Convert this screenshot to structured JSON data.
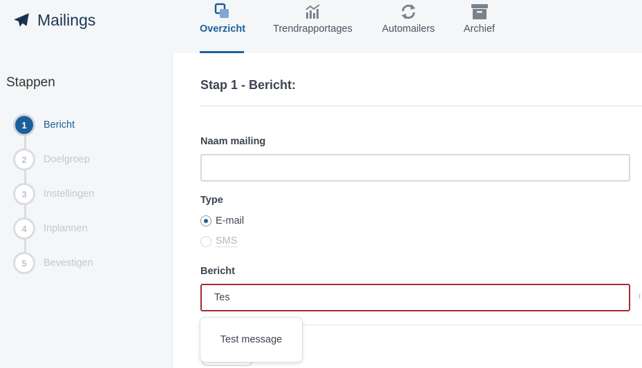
{
  "app": {
    "title": "Mailings",
    "icon": "paper-plane-icon"
  },
  "nav": {
    "tabs": [
      {
        "label": "Overzicht",
        "icon": "overview-squares-icon",
        "active": true
      },
      {
        "label": "Trendrapportages",
        "icon": "bar-chart-trend-icon",
        "active": false
      },
      {
        "label": "Automailers",
        "icon": "refresh-cycle-icon",
        "active": false
      },
      {
        "label": "Archief",
        "icon": "archive-box-icon",
        "active": false
      }
    ]
  },
  "sidebar": {
    "title": "Stappen",
    "steps": [
      {
        "number": "1",
        "label": "Bericht",
        "active": true
      },
      {
        "number": "2",
        "label": "Doelgroep",
        "active": false
      },
      {
        "number": "3",
        "label": "Instellingen",
        "active": false
      },
      {
        "number": "4",
        "label": "Inplannen",
        "active": false
      },
      {
        "number": "5",
        "label": "Bevestigen",
        "active": false
      }
    ]
  },
  "form": {
    "title": "Stap 1 - Bericht:",
    "name_label": "Naam mailing",
    "name_value": "",
    "type_label": "Type",
    "type_options": [
      {
        "label": "E-mail",
        "checked": true,
        "disabled": false
      },
      {
        "label": "SMS",
        "checked": false,
        "disabled": true
      }
    ],
    "message_label": "Bericht",
    "message_value": "Tes",
    "autocomplete_suggestion": "Test message"
  },
  "colors": {
    "accent": "#1c5f99",
    "brand": "#1c3552",
    "error_border": "#a32a30",
    "background": "#f4f6f8"
  }
}
